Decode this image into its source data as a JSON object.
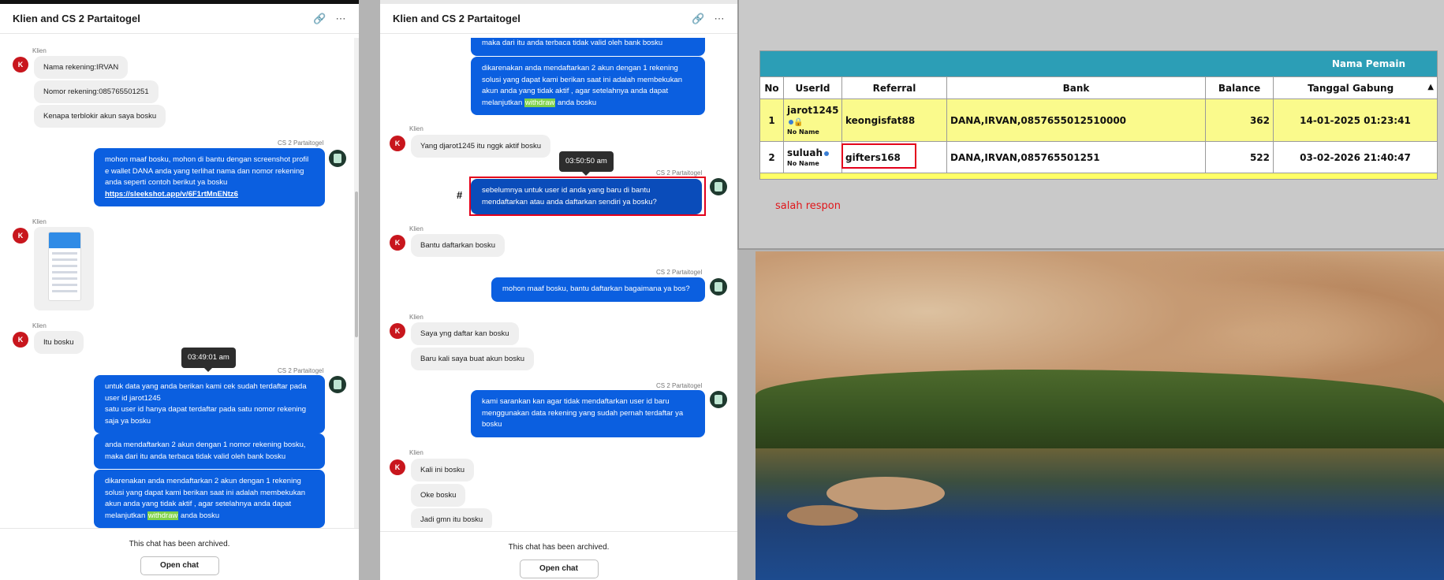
{
  "panel1": {
    "title": "Klien and CS 2 Partaitogel",
    "client_label": "Klien",
    "agent_label": "CS 2 Partaitogel",
    "avatar_letter": "K",
    "messages": {
      "c1": "Nama rekening:IRVAN",
      "c2": "Nomor rekening:085765501251",
      "c3": "Kenapa terblokir akun saya bosku",
      "a1_text": "mohon maaf bosku, mohon di bantu dengan screenshot profil e wallet DANA anda yang terlihat nama dan nomor rekening anda seperti contoh berikut ya bosku",
      "a1_link": "https://sleekshot.app/v/6F1rtMnENtz6",
      "c4": "Itu bosku",
      "tooltip": "03:49:01 am",
      "a2": "untuk data yang anda berikan kami cek sudah terdaftar pada user id jarot1245\nsatu user id hanya dapat terdaftar pada satu nomor rekening saja ya bosku",
      "a3": "anda mendaftarkan 2 akun dengan 1 nomor rekening bosku, maka dari itu anda terbaca tidak valid oleh bank bosku",
      "a4_pre": "dikarenakan anda mendaftarkan 2 akun dengan 1 rekening solusi yang dapat kami berikan saat ini adalah membekukan akun anda yang tidak aktif , agar setelahnya anda dapat melanjutkan",
      "a4_hl": "withdraw",
      "a4_post": "anda bosku"
    },
    "archived": "This chat has been archived.",
    "open_chat": "Open chat"
  },
  "panel2": {
    "title": "Klien and CS 2 Partaitogel",
    "client_label": "Klien",
    "agent_label": "CS 2 Partaitogel",
    "avatar_letter": "K",
    "hash": "#",
    "messages": {
      "a0": "maka dari itu anda terbaca tidak valid oleh bank bosku",
      "a1_pre": "dikarenakan anda mendaftarkan 2 akun dengan 1 rekening solusi yang dapat kami berikan saat ini adalah membekukan akun anda yang tidak aktif , agar setelahnya anda dapat melanjutkan",
      "a1_hl": "withdraw",
      "a1_post": "anda bosku",
      "c1": "Yang djarot1245 itu nggk aktif bosku",
      "tooltip": "03:50:50 am",
      "a2": "sebelumnya untuk user id anda yang baru di bantu mendaftarkan atau anda daftarkan sendiri ya bosku?",
      "c2": "Bantu daftarkan bosku",
      "a3": "mohon maaf bosku, bantu daftarkan bagaimana ya bos?",
      "c3": "Saya yng daftar kan bosku",
      "c4": "Baru kali saya buat akun bosku",
      "a4": "kami sarankan kan agar tidak mendaftarkan user id baru menggunakan data rekening yang sudah pernah terdaftar ya bosku",
      "c5": "Kali ini bosku",
      "c6": "Oke bosku",
      "c7": "Jadi gmn itu bosku"
    },
    "archived": "This chat has been archived.",
    "open_chat": "Open chat"
  },
  "table": {
    "caption": "Nama Pemain",
    "headers": [
      "No",
      "UserId",
      "Referral",
      "Bank",
      "Balance",
      "Tanggal Gabung"
    ],
    "sort_indicator": "▲",
    "rows": [
      {
        "no": "1",
        "userid": "jarot1245",
        "sub": "No Name",
        "referral": "keongisfat88",
        "bank": "DANA,IRVAN,0857655012510000",
        "balance": "362",
        "date": "14-01-2025 01:23:41"
      },
      {
        "no": "2",
        "userid": "suluah",
        "sub": "No Name",
        "referral": "gifters168",
        "bank": "DANA,IRVAN,085765501251",
        "balance": "522",
        "date": "03-02-2026 21:40:47"
      }
    ],
    "note": "salah respon"
  }
}
